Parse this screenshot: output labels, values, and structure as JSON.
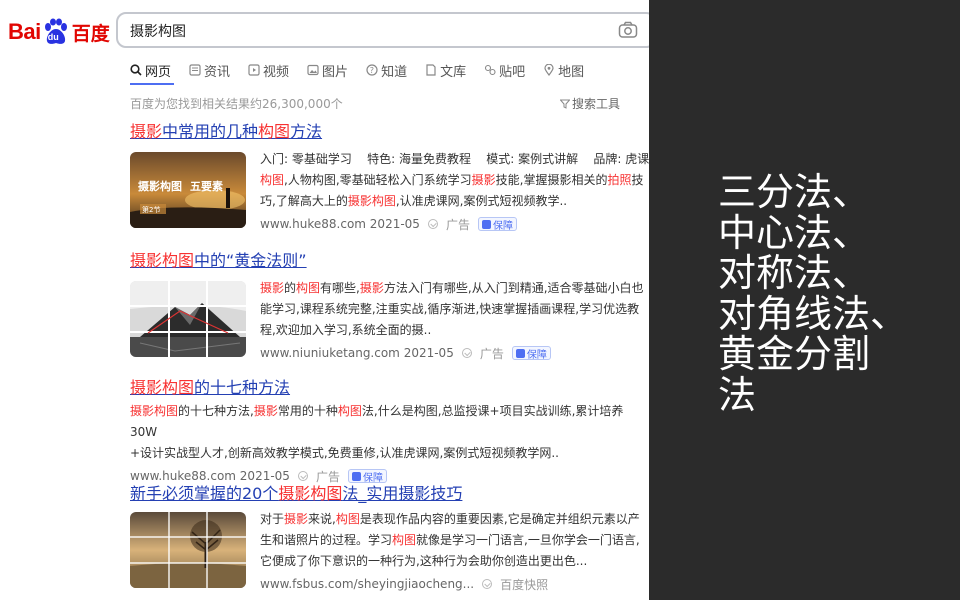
{
  "logo": {
    "bai": "Bai",
    "du": "du",
    "cn": "百度"
  },
  "search": {
    "value": "摄影构图",
    "camera_icon": "camera-icon"
  },
  "tabs": [
    {
      "label": "网页",
      "icon": "search-icon",
      "active": true
    },
    {
      "label": "资讯",
      "icon": "news-icon"
    },
    {
      "label": "视频",
      "icon": "video-icon"
    },
    {
      "label": "图片",
      "icon": "image-icon"
    },
    {
      "label": "知道",
      "icon": "question-icon"
    },
    {
      "label": "文库",
      "icon": "document-icon"
    },
    {
      "label": "贴吧",
      "icon": "forum-icon"
    },
    {
      "label": "地图",
      "icon": "map-icon"
    }
  ],
  "result_count": "百度为您找到相关结果约26,300,000个",
  "search_tools": "搜索工具",
  "results": [
    {
      "title": "摄影中常用的几种构图方法",
      "body_lines": [
        "入门: 零基础学习    特色: 海量免费教程    模式: 案例式讲解    品牌: 虎课",
        "构图,人物构图,零基础轻松入门系统学习摄影技能,掌握摄影相关的拍照技",
        "巧,了解高大上的摄影构图,认准虎课网,案例式短视频教学.."
      ],
      "source": "www.huke88.com 2021-05",
      "ad": "广告",
      "badge": "保障"
    },
    {
      "title": "摄影构图中的“黄金法则”",
      "body_lines": [
        "摄影的构图有哪些,摄影方法入门有哪些,从入门到精通,适合零基础小白也",
        "能学习,课程系统完整,注重实战,循序渐进,快速掌握插画课程,学习优选教",
        "程,欢迎加入学习,系统全面的摄.."
      ],
      "source": "www.niuniuketang.com 2021-05",
      "ad": "广告",
      "badge": "保障"
    },
    {
      "title": "摄影构图的十七种方法",
      "body_lines": [
        "摄影构图的十七种方法,摄影常用的十种构图法,什么是构图,总监授课+项目实战训练,累计培养30W",
        "+设计实战型人才,创新高效教学模式,免费重修,认准虎课网,案例式短视频教学网.."
      ],
      "source": "www.huke88.com 2021-05",
      "ad": "广告",
      "badge": "保障"
    },
    {
      "title": "新手必须掌握的20个摄影构图法_实用摄影技巧",
      "body_lines": [
        "对于摄影来说,构图是表现作品内容的重要因素,它是确定并组织元素以产",
        "生和谐照片的过程。学习构图就像是学习一门语言,一旦你学会一门语言,",
        "它便成了你下意识的一种行为,这种行为会助你创造出更出色..."
      ],
      "source": "www.fsbus.com/sheyingjiaocheng...",
      "ad": "百度快照"
    }
  ],
  "thumb1_text": {
    "line1": "摄影构图",
    "line2": "五要素",
    "tag": "第2节"
  },
  "right_panel": {
    "lines": [
      "三分法、",
      "中心法、",
      "对称法、",
      "对角线法、",
      "黄金分割",
      "法"
    ]
  },
  "colors": {
    "link": "#2440b3",
    "highlight": "#f73131",
    "brand": "#e10602",
    "panel": "#2b2b2b"
  }
}
